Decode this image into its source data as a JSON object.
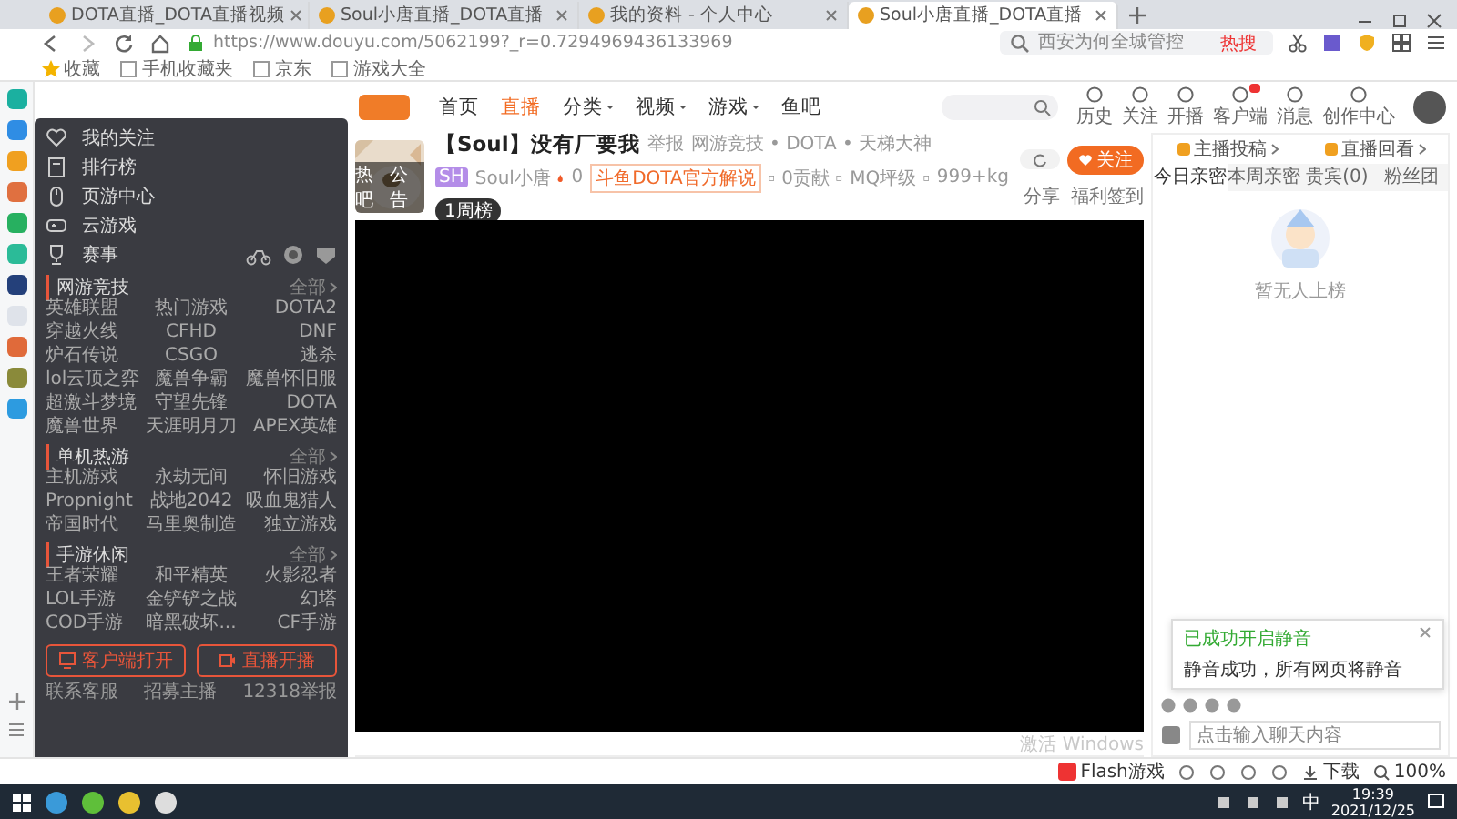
{
  "browser": {
    "tabs": [
      {
        "title": "DOTA直播_DOTA直播视频",
        "selected": false
      },
      {
        "title": "Soul小唐直播_DOTA直播",
        "selected": false
      },
      {
        "title": "我的资料 - 个人中心",
        "selected": false
      },
      {
        "title": "Soul小唐直播_DOTA直播",
        "selected": true
      }
    ],
    "url": "https://www.douyu.com/5062199?_r=0.7294969436133969",
    "search": {
      "placeholder": "西安为何全城管控"
    },
    "hot_label": "热搜",
    "bookmarks": [
      "收藏",
      "手机收藏夹",
      "京东",
      "游戏大全"
    ]
  },
  "site": {
    "nav": [
      {
        "label": "首页",
        "selected": false,
        "dropdown": false
      },
      {
        "label": "直播",
        "selected": true,
        "dropdown": false
      },
      {
        "label": "分类",
        "selected": false,
        "dropdown": true
      },
      {
        "label": "视频",
        "selected": false,
        "dropdown": true
      },
      {
        "label": "游戏",
        "selected": false,
        "dropdown": true
      },
      {
        "label": "鱼吧",
        "selected": false,
        "dropdown": false
      }
    ],
    "user_links": [
      {
        "label": "历史",
        "badge": false
      },
      {
        "label": "关注",
        "badge": false
      },
      {
        "label": "开播",
        "badge": false
      },
      {
        "label": "客户端",
        "badge": true
      },
      {
        "label": "消息",
        "badge": false
      },
      {
        "label": "创作中心",
        "badge": false
      }
    ]
  },
  "menu": {
    "items": [
      "我的关注",
      "排行榜",
      "页游中心",
      "云游戏"
    ],
    "events_label": "赛事",
    "sections": [
      {
        "title": "网游竞技",
        "more": "全部",
        "games": [
          "英雄联盟",
          "热门游戏",
          "DOTA2",
          "穿越火线",
          "CFHD",
          "DNF",
          "炉石传说",
          "CSGO",
          "逃杀",
          "lol云顶之弈",
          "魔兽争霸",
          "魔兽怀旧服",
          "超激斗梦境",
          "守望先锋",
          "DOTA",
          "魔兽世界",
          "天涯明月刀",
          "APEX英雄"
        ]
      },
      {
        "title": "单机热游",
        "more": "全部",
        "games": [
          "主机游戏",
          "永劫无间",
          "怀旧游戏",
          "Propnight",
          "战地2042",
          "吸血鬼猎人",
          "帝国时代",
          "马里奥制造",
          "独立游戏"
        ]
      },
      {
        "title": "手游休闲",
        "more": "全部",
        "games": [
          "王者荣耀",
          "和平精英",
          "火影忍者",
          "LOL手游",
          "金铲铲之战",
          "幻塔",
          "COD手游",
          "暗黑破坏...",
          "CF手游"
        ]
      }
    ],
    "buttons": [
      "客户端打开",
      "直播开播"
    ],
    "footer": [
      "联系客服",
      "招募主播",
      "12318举报"
    ]
  },
  "stream": {
    "title": "【Soul】没有厂要我",
    "report": "举报",
    "category": "网游竞技 • DOTA • 天梯大神",
    "avatar_labels": [
      "热吧",
      "公告"
    ],
    "level": "SH",
    "anchor": "Soul小唐",
    "heat": "0",
    "tag": "斗鱼DOTA官方解说",
    "stats": [
      "0贡献",
      "MQ坪级",
      "999+kg"
    ],
    "rank_badge": "1周榜",
    "follow": "关注",
    "share": "分享",
    "signin": "福利签到"
  },
  "panel": {
    "links": [
      "主播投稿",
      "直播回看"
    ],
    "tabs": [
      {
        "label": "今日亲密",
        "selected": true
      },
      {
        "label": "本周亲密",
        "selected": false
      },
      {
        "label": "贵宾(0)",
        "selected": false
      },
      {
        "label": "粉丝团",
        "selected": false
      }
    ],
    "empty": "暂无人上榜",
    "chat_placeholder": "点击输入聊天内容"
  },
  "os_watermark": "激活 Windows",
  "notification": {
    "title": "已成功开启静音",
    "body": "静音成功，所有网页将静音"
  },
  "status": {
    "flash": "Flash游戏",
    "download": "下载",
    "zoom": "100%"
  },
  "taskbar": {
    "ime": "中",
    "time": "19:39",
    "date": "2021/12/25"
  }
}
